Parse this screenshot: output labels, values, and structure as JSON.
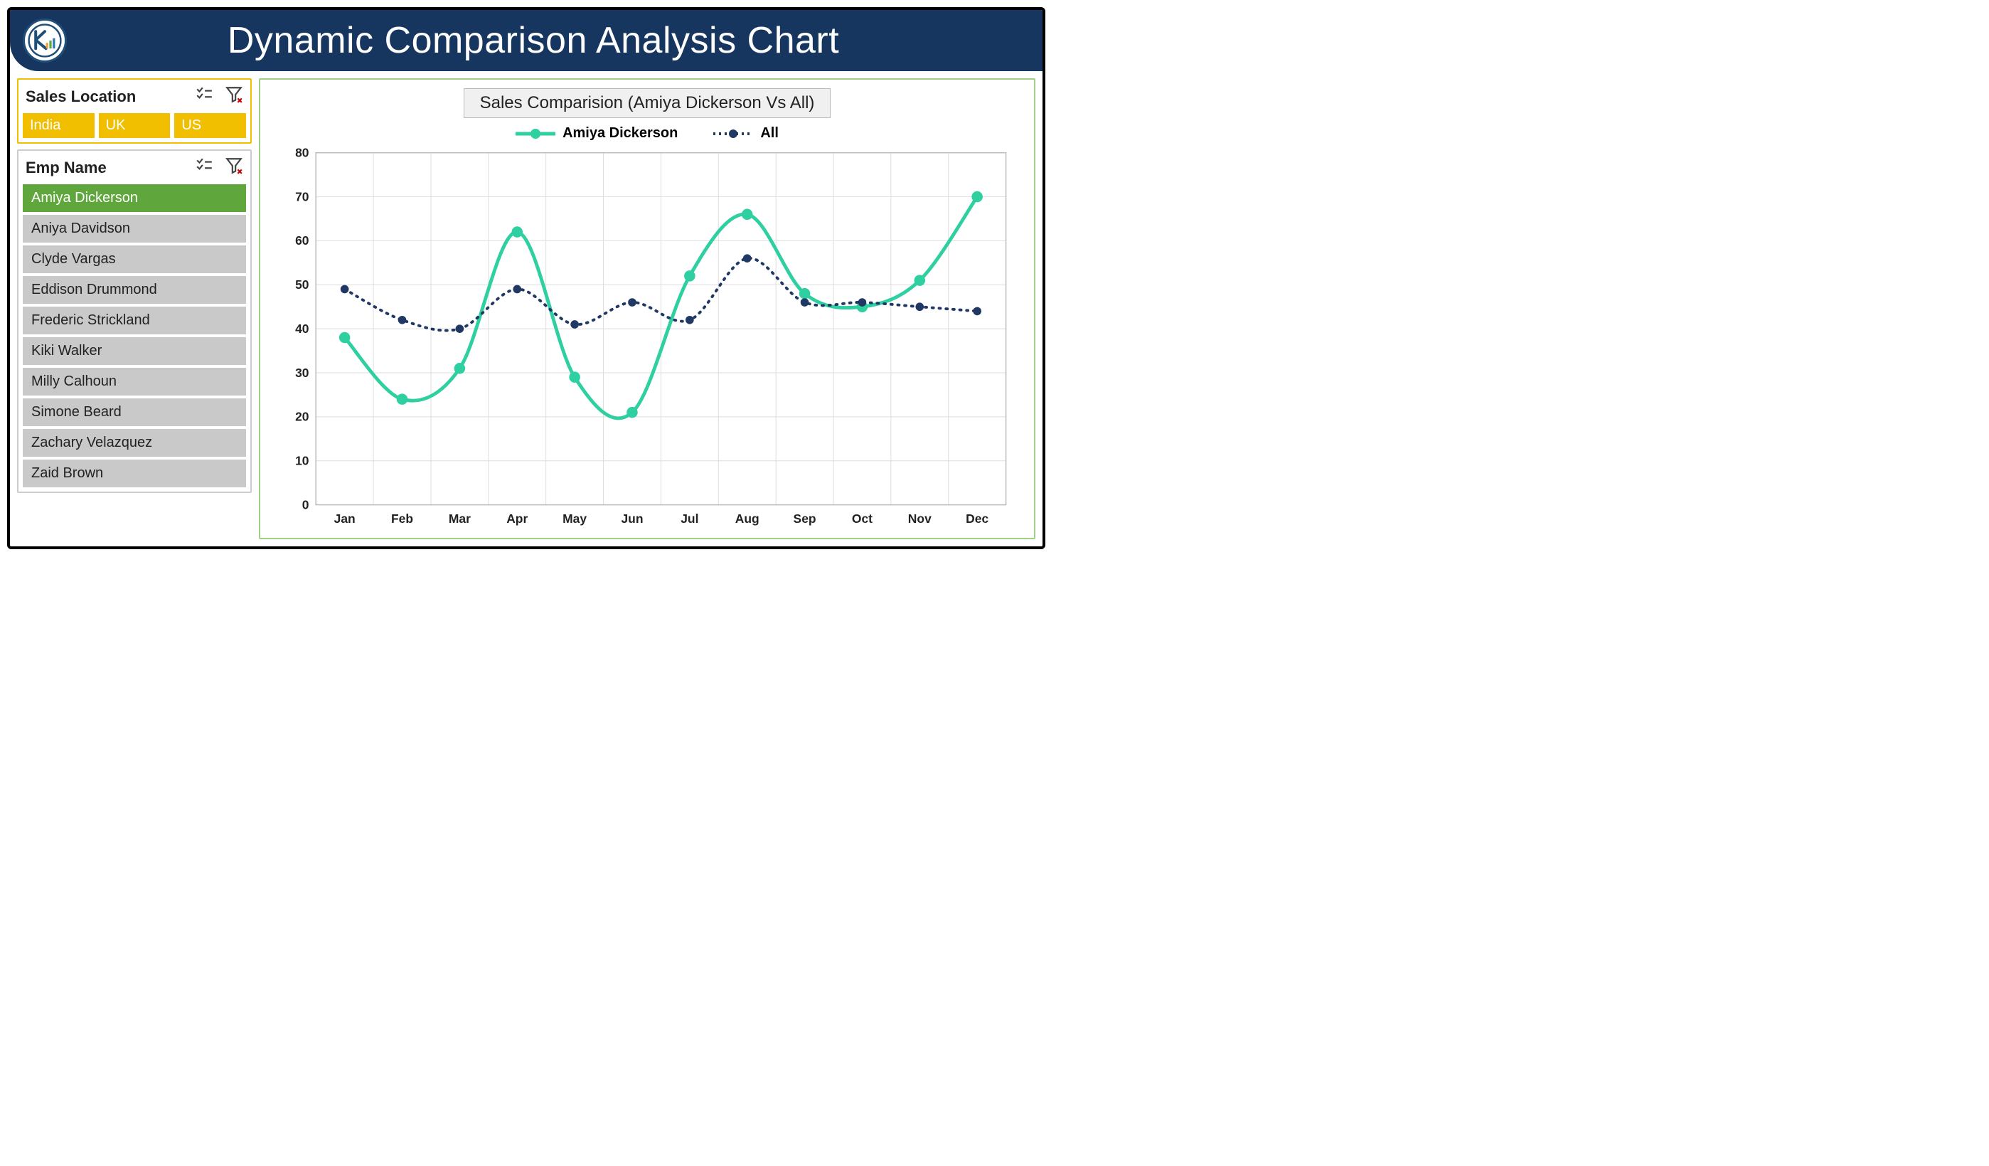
{
  "header": {
    "title": "Dynamic Comparison Analysis Chart"
  },
  "slicers": {
    "location": {
      "title": "Sales Location",
      "options": [
        "India",
        "UK",
        "US"
      ]
    },
    "employee": {
      "title": "Emp Name",
      "selected": "Amiya Dickerson",
      "items": [
        "Amiya Dickerson",
        "Aniya Davidson",
        "Clyde Vargas",
        "Eddison Drummond",
        "Frederic Strickland",
        "Kiki Walker",
        "Milly Calhoun",
        "Simone Beard",
        "Zachary Velazquez",
        "Zaid Brown"
      ]
    }
  },
  "chart": {
    "title": "Sales Comparision (Amiya Dickerson Vs All)",
    "legend": {
      "a": "Amiya Dickerson",
      "b": "All"
    }
  },
  "chart_data": {
    "type": "line",
    "title": "Sales Comparision (Amiya Dickerson Vs All)",
    "xlabel": "",
    "ylabel": "",
    "ylim": [
      0,
      80
    ],
    "yticks": [
      0,
      10,
      20,
      30,
      40,
      50,
      60,
      70,
      80
    ],
    "categories": [
      "Jan",
      "Feb",
      "Mar",
      "Apr",
      "May",
      "Jun",
      "Jul",
      "Aug",
      "Sep",
      "Oct",
      "Nov",
      "Dec"
    ],
    "series": [
      {
        "name": "Amiya Dickerson",
        "color": "#2ecfa1",
        "style": "solid",
        "values": [
          38,
          24,
          31,
          62,
          29,
          21,
          52,
          66,
          48,
          45,
          51,
          70
        ]
      },
      {
        "name": "All",
        "color": "#203864",
        "style": "dotted",
        "values": [
          49,
          42,
          40,
          49,
          41,
          46,
          42,
          56,
          46,
          46,
          45,
          44
        ]
      }
    ]
  },
  "colors": {
    "headerBg": "#16365f",
    "accent": "#f2bf00",
    "teal": "#2ecfa1",
    "navy": "#203864"
  }
}
